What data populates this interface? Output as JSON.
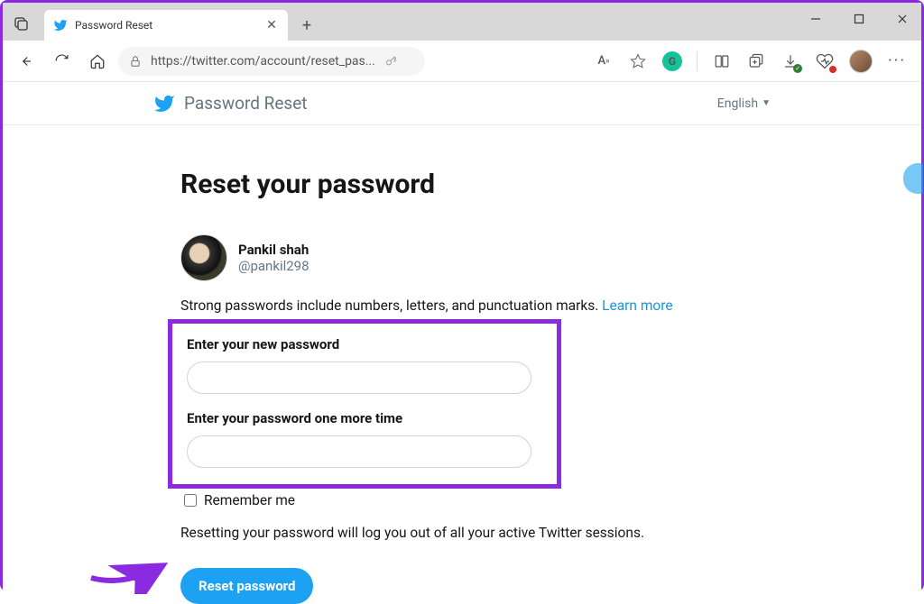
{
  "browser": {
    "tab_title": "Password Reset",
    "url_display": "https://twitter.com/account/reset_pas...",
    "language": "English"
  },
  "header": {
    "title": "Password Reset"
  },
  "main": {
    "heading": "Reset your password",
    "user_name": "Pankil shah",
    "user_handle": "@pankil298",
    "desc_text": "Strong passwords include numbers, letters, and punctuation marks. ",
    "learn_more": "Learn more",
    "label_new": "Enter your new password",
    "label_confirm": "Enter your password one more time",
    "remember": "Remember me",
    "note": "Resetting your password will log you out of all your active Twitter sessions.",
    "reset_button": "Reset password"
  }
}
